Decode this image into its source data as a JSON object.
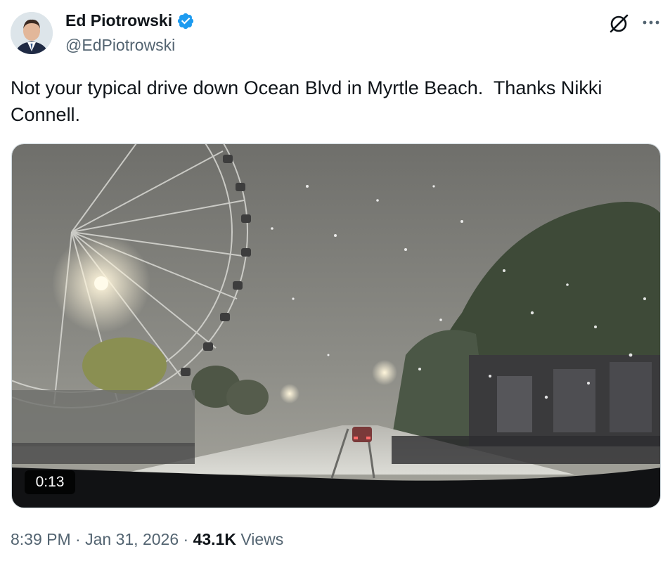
{
  "author": {
    "name": "Ed Piotrowski",
    "handle": "@EdPiotrowski",
    "verified": true
  },
  "tweet": {
    "text": "Not your typical drive down Ocean Blvd in Myrtle Beach.  Thanks Nikki Connell."
  },
  "media": {
    "duration": "0:13"
  },
  "meta": {
    "time": "8:39 PM",
    "separator": " · ",
    "date": "Jan 31, 2026",
    "views_count": "43.1K",
    "views_label": "Views"
  },
  "icons": {
    "grok": "grok-icon",
    "more": "more-icon",
    "verified": "verified-badge-icon"
  },
  "colors": {
    "verified_blue": "#1d9bf0",
    "secondary_text": "#536471",
    "primary_text": "#0f1419"
  }
}
